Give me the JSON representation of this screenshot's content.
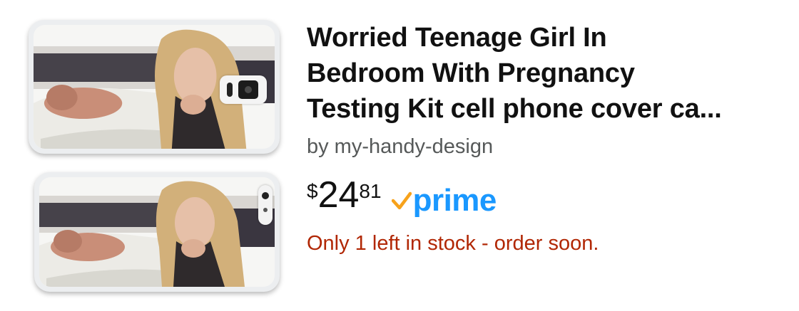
{
  "product": {
    "title_lines": [
      "Worried Teenage Girl In",
      "Bedroom With Pregnancy",
      "Testing Kit cell phone cover ca..."
    ],
    "byline": "by my-handy-design",
    "price": {
      "symbol": "$",
      "whole": "24",
      "fraction": "81"
    },
    "prime_label": "prime",
    "stock_message": "Only 1 left in stock - order soon."
  },
  "colors": {
    "title": "#111111",
    "byline": "#565959",
    "stock": "#b12704",
    "prime_blue": "#1a98ff",
    "prime_check": "#f7a21b"
  },
  "icons": {
    "prime": "prime-check-icon",
    "camera": "camera-icon"
  }
}
